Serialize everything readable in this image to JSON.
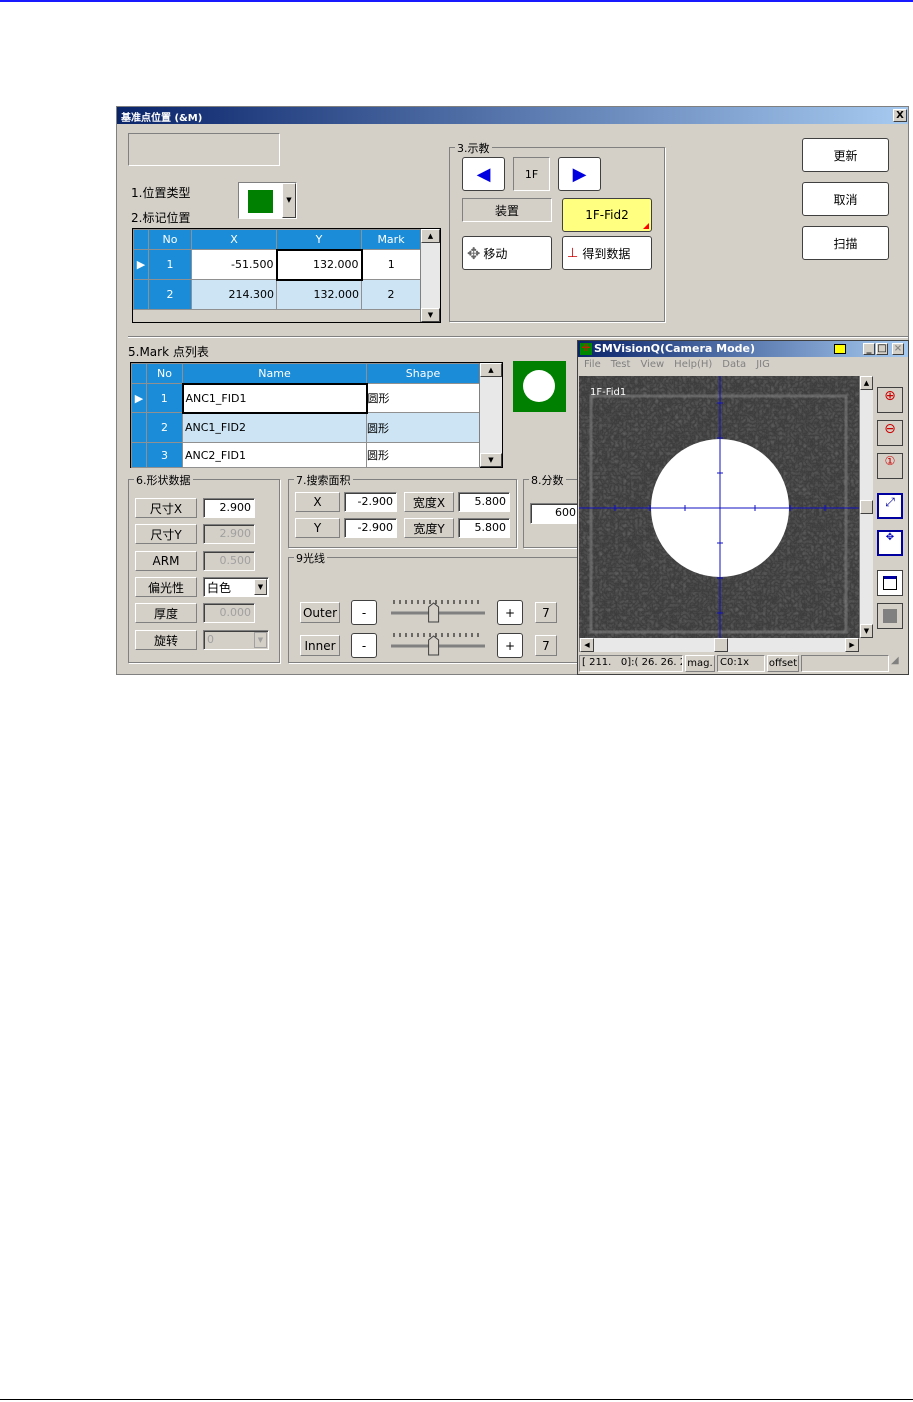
{
  "dialog": {
    "title": "基准点位置 (&M)",
    "close": "X"
  },
  "section1": {
    "label": "1.位置类型",
    "color": "#008000"
  },
  "section2": {
    "label": "2.标记位置",
    "columns": [
      "No",
      "X",
      "Y",
      "Mark"
    ],
    "rows": [
      {
        "no": "1",
        "x": "-51.500",
        "y": "132.000",
        "mark": "1"
      },
      {
        "no": "2",
        "x": "214.300",
        "y": "132.000",
        "mark": "2"
      }
    ]
  },
  "section3": {
    "label": "3.示教",
    "floor": "1F",
    "device": "装置",
    "target": "1F-Fid2",
    "move": "移动",
    "get_data": "得到数据"
  },
  "actions": {
    "update": "更新",
    "cancel": "取消",
    "scan": "扫描"
  },
  "section5": {
    "label": "5.Mark 点列表",
    "columns": [
      "No",
      "Name",
      "Shape"
    ],
    "rows": [
      {
        "no": "1",
        "name": "ANC1_FID1",
        "shape": "圆形"
      },
      {
        "no": "2",
        "name": "ANC1_FID2",
        "shape": "圆形"
      },
      {
        "no": "3",
        "name": "ANC2_FID1",
        "shape": "圆形"
      }
    ]
  },
  "section6": {
    "label": "6.形状数据",
    "size_x_label": "尺寸X",
    "size_x": "2.900",
    "size_y_label": "尺寸Y",
    "size_y": "2.900",
    "arm_label": "ARM",
    "arm": "0.500",
    "polarity_label": "偏光性",
    "polarity": "白色",
    "thickness_label": "厚度",
    "thickness": "0.000",
    "rotation_label": "旋转",
    "rotation": "0"
  },
  "section7": {
    "label": "7.搜索面积",
    "x_label": "X",
    "x": "-2.900",
    "y_label": "Y",
    "y": "-2.900",
    "wx_label": "宽度X",
    "wx": "5.800",
    "wy_label": "宽度Y",
    "wy": "5.800"
  },
  "section8": {
    "label": "8.分数",
    "score": "600"
  },
  "section9": {
    "label": "9光线",
    "outer_label": "Outer",
    "outer_value": "7",
    "inner_label": "Inner",
    "inner_value": "7",
    "minus": "-",
    "plus": "+",
    "outer_level": 0.45,
    "inner_level": 0.45
  },
  "camera": {
    "title": "SMVisionQ(Camera Mode)",
    "menu": [
      "File",
      "Test",
      "View",
      "Help(H)",
      "Data",
      "JIG"
    ],
    "overlay": "1F-Fid1",
    "status": [
      "[ 211.   0]:( 26. 26. 2(",
      "mag.",
      "C0:1x",
      "offset",
      ""
    ]
  }
}
